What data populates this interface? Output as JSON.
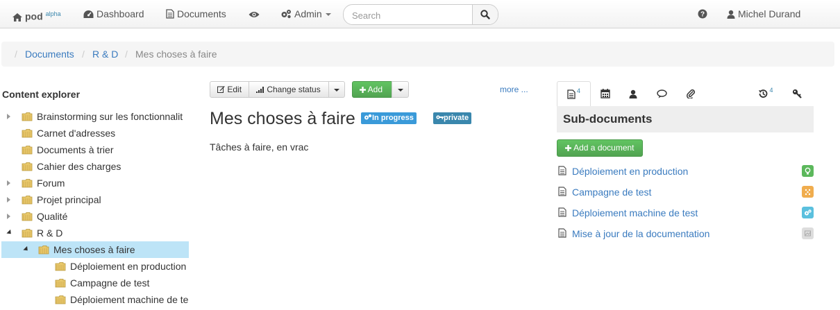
{
  "navbar": {
    "brand": "pod",
    "brand_sup": "alpha",
    "dashboard": "Dashboard",
    "documents": "Documents",
    "admin": "Admin",
    "search_placeholder": "Search",
    "user": "Michel Durand"
  },
  "breadcrumb": {
    "items": [
      "Documents",
      "R & D"
    ],
    "active": "Mes choses à faire"
  },
  "explorer": {
    "title": "Content explorer",
    "items": [
      {
        "label": "Brainstorming sur les fonctionnalit",
        "toggle": "collapsed"
      },
      {
        "label": "Carnet d'adresses",
        "toggle": "none"
      },
      {
        "label": "Documents à trier",
        "toggle": "none"
      },
      {
        "label": "Cahier des charges",
        "toggle": "none"
      },
      {
        "label": "Forum",
        "toggle": "collapsed"
      },
      {
        "label": "Projet principal",
        "toggle": "collapsed"
      },
      {
        "label": "Qualité",
        "toggle": "collapsed"
      },
      {
        "label": "R & D",
        "toggle": "expanded"
      },
      {
        "label": "Mes choses à faire",
        "toggle": "expanded",
        "selected": true
      },
      {
        "label": "Déploiement en production",
        "toggle": "none"
      },
      {
        "label": "Campagne de test",
        "toggle": "none"
      },
      {
        "label": "Déploiement machine de te",
        "toggle": "none"
      }
    ]
  },
  "toolbar": {
    "edit": "Edit",
    "change_status": "Change status",
    "add": "Add",
    "more": "more ..."
  },
  "document": {
    "title": "Mes choses à faire",
    "status_label": "In progress",
    "visibility_label": "private",
    "description": "Tâches à faire, en vrac"
  },
  "tabs": {
    "subdocs_count": "4",
    "history_count": "4",
    "icons": [
      "document-icon",
      "calendar-icon",
      "user-icon",
      "comments-icon",
      "paperclip-icon",
      "history-icon",
      "key-icon"
    ]
  },
  "subdocs": {
    "title": "Sub-documents",
    "add_button": "Add a document",
    "items": [
      {
        "label": "Déploiement en production",
        "status_icon": "lightbulb-icon",
        "status_color": "#5cb85c"
      },
      {
        "label": "Campagne de test",
        "status_icon": "flash-icon",
        "status_color": "#f0ad4e"
      },
      {
        "label": "Déploiement machine de test",
        "status_icon": "cogs-icon",
        "status_color": "#5bc0de"
      },
      {
        "label": "Mise à jour de la documentation",
        "status_icon": "closed-icon",
        "status_color": "#dddddd"
      }
    ]
  },
  "colors": {
    "link": "#3a7bbf",
    "selected_row": "#bde4f7",
    "success": "#51a351",
    "info_label": "#3a9ad9"
  }
}
